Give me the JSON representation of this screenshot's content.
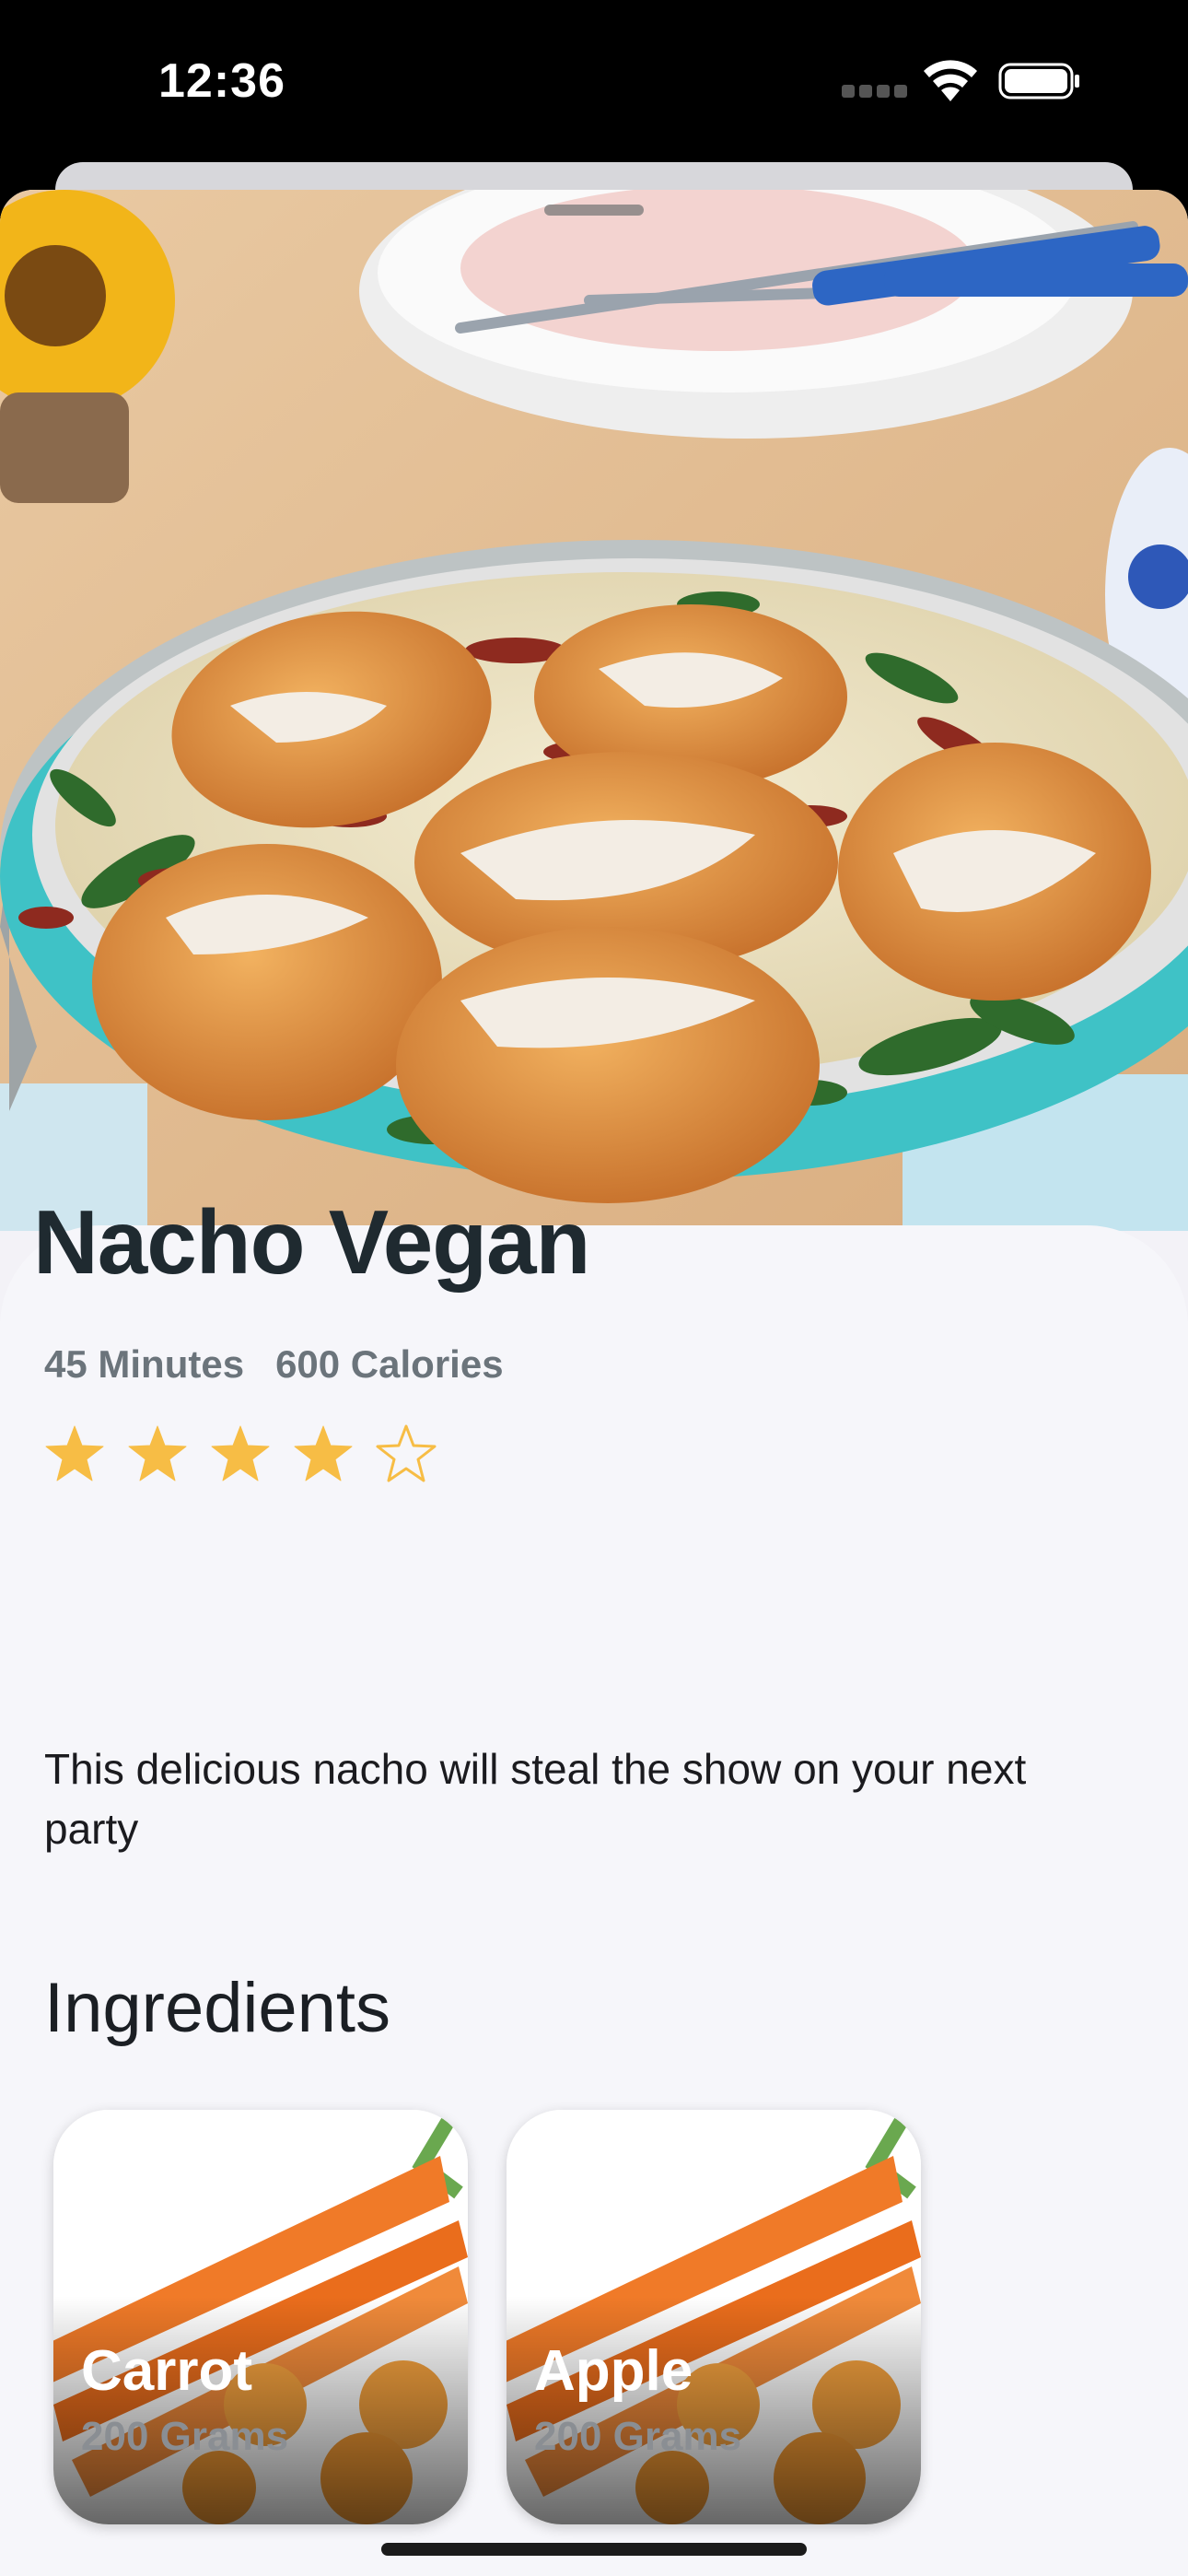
{
  "status_bar": {
    "time": "12:36"
  },
  "recipe": {
    "title": "Nacho Vegan",
    "duration": "45 Minutes",
    "calories": "600 Calories",
    "rating": 4,
    "rating_max": 5,
    "description": "This delicious nacho will steal the show on your next party"
  },
  "ingredients_section": {
    "heading": "Ingredients",
    "items": [
      {
        "name": "Carrot",
        "amount": "200 Grams"
      },
      {
        "name": "Apple",
        "amount": "200 Grams"
      }
    ]
  },
  "colors": {
    "star": "#f7bd45",
    "title": "#1f2a30",
    "meta": "#6b747b",
    "card_bg": "#f6f6fa",
    "pan": "#3fc2c6",
    "sauce": "#ece3c6",
    "chicken": "#d88a3c",
    "carrot": "#f07a28"
  },
  "icons": [
    "signal-icon",
    "wifi-icon",
    "battery-icon",
    "star-icon",
    "star-outline-icon"
  ]
}
